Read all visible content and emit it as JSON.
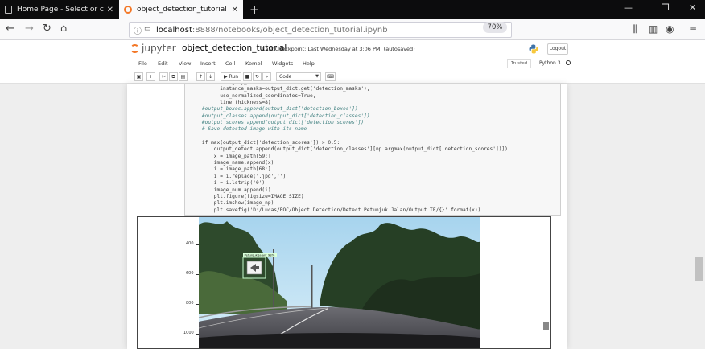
{
  "browser": {
    "tabs": [
      {
        "title": "Home Page - Select or create a"
      },
      {
        "title": "object_detection_tutorial - Jupy"
      }
    ],
    "url_host": "localhost",
    "url_rest": ":8888/notebooks/object_detection_tutorial.ipynb",
    "zoom": "70%"
  },
  "jupyter": {
    "logo_text": "jupyter",
    "notebook_name": "object_detection_tutorial",
    "checkpoint": "Last Checkpoint: Last Wednesday at 3:06 PM",
    "autosaved": "(autosaved)",
    "logout_label": "Logout",
    "menu": [
      "File",
      "Edit",
      "View",
      "Insert",
      "Cell",
      "Kernel",
      "Widgets",
      "Help"
    ],
    "trusted": "Trusted",
    "kernel_name": "Python 3",
    "toolbar": {
      "run_label": "Run",
      "cell_type": "Code"
    }
  },
  "code_lines": [
    {
      "t": "          category_index,",
      "c": false
    },
    {
      "t": "          instance_masks=output_dict.get('detection_masks'),",
      "c": false
    },
    {
      "t": "          use_normalized_coordinates=True,",
      "c": false
    },
    {
      "t": "          line_thickness=8)",
      "c": false
    },
    {
      "t": "    #output_boxes.append(output_dict['detection_boxes'])",
      "c": true
    },
    {
      "t": "    #output_classes.append(output_dict['detection_classes'])",
      "c": true
    },
    {
      "t": "    #output_scores.append(output_dict['detection_scores'])",
      "c": true
    },
    {
      "t": "    # Save detected image with its name",
      "c": true
    },
    {
      "t": "",
      "c": false
    },
    {
      "t": "    if max(output_dict['detection_scores']) > 0.5:",
      "c": false
    },
    {
      "t": "        output_detect.append(output_dict['detection_classes'][np.argmax(output_dict['detection_scores'])])",
      "c": false
    },
    {
      "t": "        x = image_path[59:]",
      "c": false
    },
    {
      "t": "        image_name.append(x)",
      "c": false
    },
    {
      "t": "        i = image_path[68:]",
      "c": false
    },
    {
      "t": "        i = i.replace('.jpg','')",
      "c": false
    },
    {
      "t": "        i = i.lstrip('0')",
      "c": false
    },
    {
      "t": "        image_num.append(i)",
      "c": false
    },
    {
      "t": "        plt.figure(figsize=IMAGE_SIZE)",
      "c": false
    },
    {
      "t": "        plt.imshow(image_np)",
      "c": false
    },
    {
      "t": "        plt.savefig('D:/Lucas/POC/Object Detection/Detect Petunjuk Jalan/Output TF/{}'.format(x))",
      "c": false
    }
  ],
  "plot": {
    "yticks": [
      "400",
      "600",
      "800",
      "1000"
    ],
    "detection_label": "Petunjuk Jalan: 98%"
  }
}
